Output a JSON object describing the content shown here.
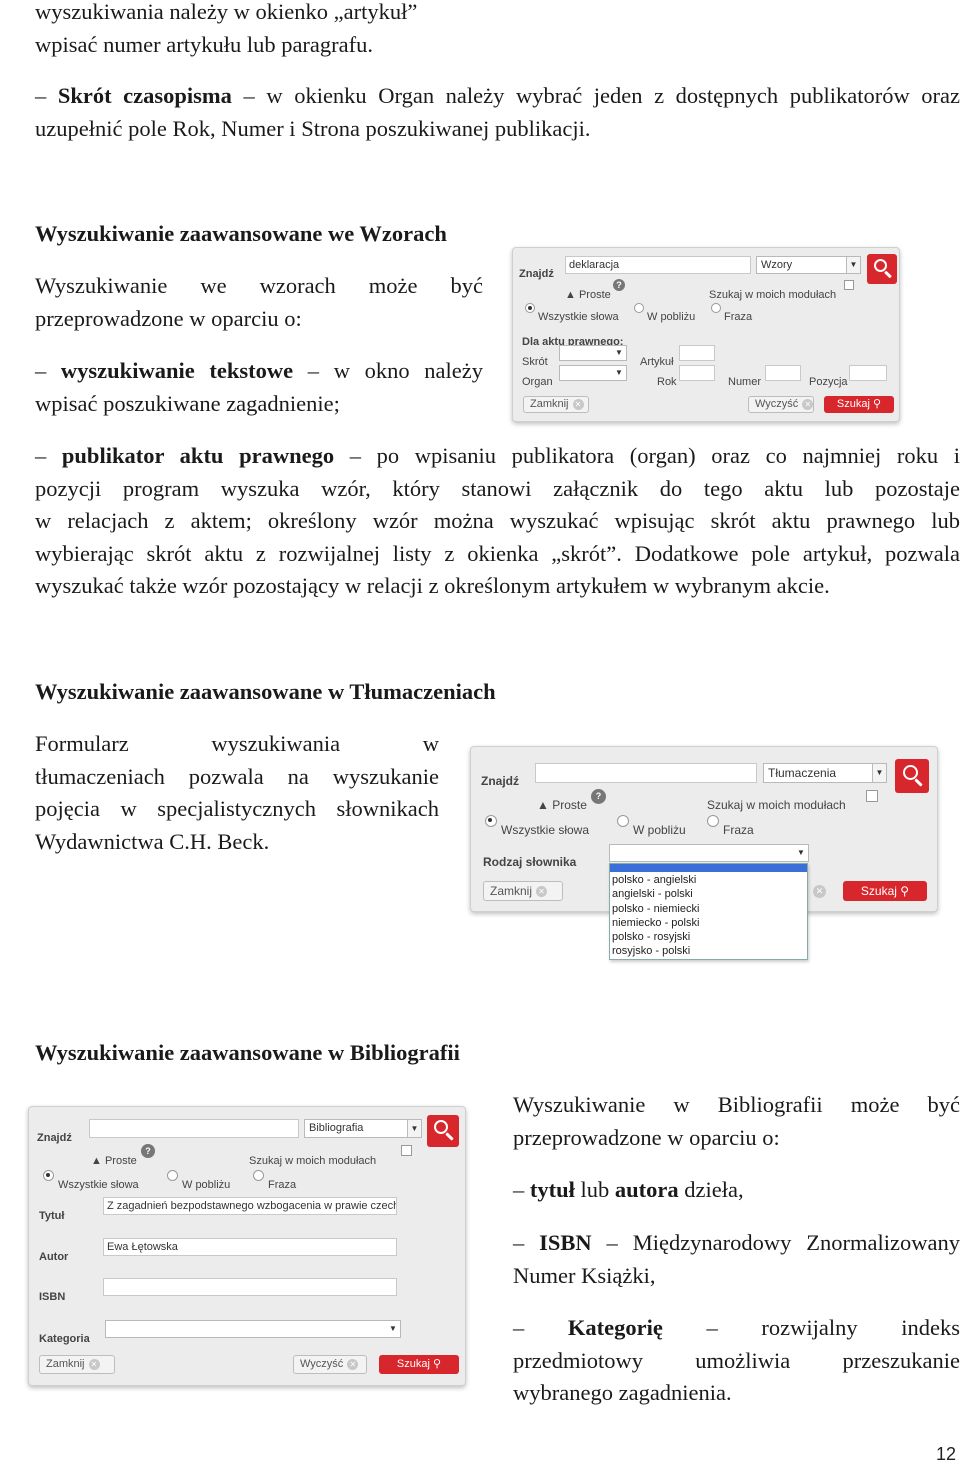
{
  "top": {
    "line1": "wyszukiwania należy w okienko „artykuł”",
    "line2": "wpisać numer artykułu lub paragrafu.",
    "skrot_term": "Skrót czasopisma",
    "skrot_line1_rest": " – w okienku Organ należy wybrać jeden z dostępnych publikatorów oraz",
    "skrot_line2": "uzupełnić pole Rok, Numer i Strona poszukiwanej publikacji."
  },
  "section_wzory": {
    "heading": "Wyszukiwanie zaawansowane we Wzorach",
    "intro_line1": "Wyszukiwanie we wzorach może być",
    "intro_line2": "przeprowadzone w oparciu o:",
    "item1_term": "wyszukiwanie tekstowe",
    "item1_line1_rest": " – w okno należy",
    "item1_line2": "wpisać poszukiwane zagadnienie;",
    "item2_term": "publikator aktu prawnego",
    "item2_lines": [
      " – po wpisaniu publikatora (organ) oraz co najmniej roku i",
      "pozycji program wyszuka wzór, który stanowi załącznik do tego aktu lub pozostaje",
      "w relacjach z aktem; określony wzór można wyszukać wpisując skrót aktu prawnego lub",
      "wybierając skrót aktu z rozwijalnej listy z okienka „skrót”. Dodatkowe pole artykuł, pozwala",
      "wyszukać także wzór pozostający w relacji z określonym artykułem w wybranym akcie."
    ],
    "form": {
      "znajdz_label": "Znajdź",
      "search_value": "deklaracja",
      "scope_select": "Wzory",
      "proste_label": "Proste",
      "module_search_label": "Szukaj w moich modułach",
      "radio_all": "Wszystkie słowa",
      "radio_near": "W pobliżu",
      "radio_phrase": "Fraza",
      "act_section_label": "Dla aktu prawnego:",
      "skrot_label": "Skrót",
      "artykul_label": "Artykuł",
      "organ_label": "Organ",
      "rok_label": "Rok",
      "numer_label": "Numer",
      "pozycja_label": "Pozycja",
      "close_label": "Zamknij",
      "clear_label": "Wyczyść",
      "search_label": "Szukaj"
    }
  },
  "section_tlumaczenia": {
    "heading": "Wyszukiwanie zaawansowane w Tłumaczeniach",
    "lines": [
      "Formularz wyszukiwania w",
      "tłumaczeniach pozwala na wyszukanie",
      "pojęcia w specjalistycznych słownikach",
      "Wydawnictwa C.H. Beck."
    ],
    "form": {
      "znajdz_label": "Znajdź",
      "scope_select": "Tłumaczenia",
      "proste_label": "Proste",
      "module_search_label": "Szukaj w moich modułach",
      "radio_all": "Wszystkie słowa",
      "radio_near": "W pobliżu",
      "radio_phrase": "Fraza",
      "dict_label": "Rodzaj słownika",
      "dict_options": [
        "polsko - angielski",
        "angielski - polski",
        "polsko - niemiecki",
        "niemiecko - polski",
        "polsko - rosyjski",
        "rosyjsko - polski"
      ],
      "close_label": "Zamknij",
      "search_label": "Szukaj"
    }
  },
  "section_bibliografia": {
    "heading": "Wyszukiwanie zaawansowane w Bibliografii",
    "intro_line1": "Wyszukiwanie w Bibliografii może być",
    "intro_line2": "przeprowadzone w oparciu o:",
    "item1_term_a": "tytuł",
    "item1_mid": " lub ",
    "item1_term_b": "autora",
    "item1_rest": " dzieła,",
    "item2_term": "ISBN",
    "item2_line1_rest": " – Międzynarodowy Znormalizowany",
    "item2_line2": "Numer Książki,",
    "item3_term": "Kategorię",
    "item3_line1_rest": "rozwijalny indeks",
    "item3_line2": "przedmiotowy umożliwia przeszukanie",
    "item3_line3": "wybranego zagadnienia.",
    "form": {
      "znajdz_label": "Znajdź",
      "scope_select": "Bibliografia",
      "proste_label": "Proste",
      "module_search_label": "Szukaj w moich modułach",
      "radio_all": "Wszystkie słowa",
      "radio_near": "W pobliżu",
      "radio_phrase": "Fraza",
      "title_label": "Tytuł",
      "title_value": "Z zagadnień bezpodstawnego wzbogacenia w prawie czechos",
      "author_label": "Autor",
      "author_value": "Ewa Łętowska",
      "isbn_label": "ISBN",
      "category_label": "Kategoria",
      "close_label": "Zamknij",
      "clear_label": "Wyczyść",
      "search_label": "Szukaj"
    }
  },
  "page_number": "12",
  "colors": {
    "accent_red": "#d8262d",
    "panel_bg": "#ececec"
  }
}
